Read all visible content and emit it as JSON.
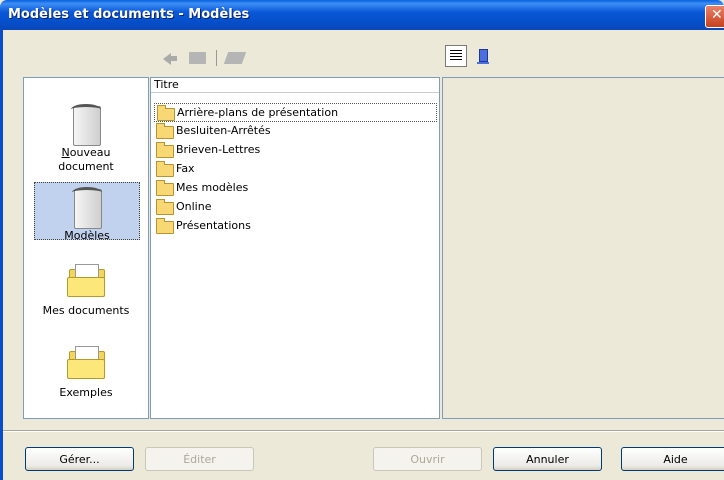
{
  "window": {
    "title": "Modèles et documents - Modèles"
  },
  "toolbar": {
    "icons": [
      "back-arrow-icon",
      "folder-up-icon",
      "print-icon"
    ],
    "view_buttons": [
      "list-view-icon",
      "document-preview-icon"
    ]
  },
  "sidebar": {
    "items": [
      {
        "label": "Nouveau document",
        "icon": "new-document-icon",
        "selected": false
      },
      {
        "label": "Modèles",
        "icon": "templates-icon",
        "selected": true
      },
      {
        "label": "Mes documents",
        "icon": "my-documents-folder-icon",
        "selected": false
      },
      {
        "label": "Exemples",
        "icon": "examples-folder-icon",
        "selected": false
      }
    ]
  },
  "filelist": {
    "column_header": "Titre",
    "rows": [
      "Arrière-plans de présentation",
      "Besluiten-Arrêtés",
      "Brieven-Lettres",
      "Fax",
      "Mes modèles",
      "Online",
      "Présentations"
    ]
  },
  "buttons": {
    "manage": "Gérer...",
    "edit": "Éditer",
    "open": "Ouvrir",
    "cancel": "Annuler",
    "help": "Aide"
  }
}
